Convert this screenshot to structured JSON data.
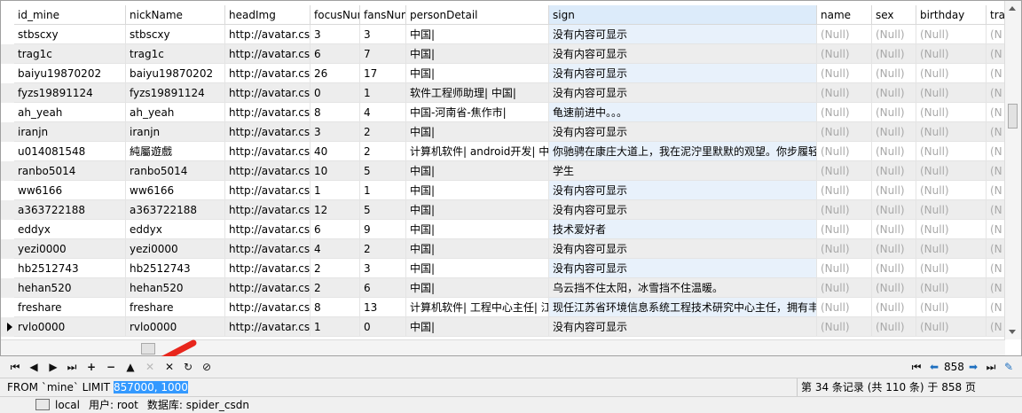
{
  "columns": [
    "id_mine",
    "nickName",
    "headImg",
    "focusNum",
    "fansNum",
    "personDetail",
    "sign",
    "name",
    "sex",
    "birthday",
    "tra"
  ],
  "rows": [
    [
      "stbscxy",
      "stbscxy",
      "http://avatar.csd",
      "3",
      "3",
      "中国|",
      "没有内容可显示",
      "(Null)",
      "(Null)",
      "(Null)",
      "(N"
    ],
    [
      "trag1c",
      "trag1c",
      "http://avatar.csd",
      "6",
      "7",
      "中国|",
      "没有内容可显示",
      "(Null)",
      "(Null)",
      "(Null)",
      "(N"
    ],
    [
      "baiyu19870202",
      "baiyu19870202",
      "http://avatar.csd",
      "26",
      "17",
      "中国|",
      "没有内容可显示",
      "(Null)",
      "(Null)",
      "(Null)",
      "(N"
    ],
    [
      "fyzs19891124",
      "fyzs19891124",
      "http://avatar.csd",
      "0",
      "1",
      "软件工程师助理| 中国|",
      "没有内容可显示",
      "(Null)",
      "(Null)",
      "(Null)",
      "(N"
    ],
    [
      "ah_yeah",
      "ah_yeah",
      "http://avatar.csd",
      "8",
      "4",
      "中国-河南省-焦作市|",
      "龟速前进中。。。",
      "(Null)",
      "(Null)",
      "(Null)",
      "(N"
    ],
    [
      "iranjn",
      "iranjn",
      "http://avatar.csd",
      "3",
      "2",
      "中国|",
      "没有内容可显示",
      "(Null)",
      "(Null)",
      "(Null)",
      "(N"
    ],
    [
      "u014081548",
      "純屬遊戲",
      "http://avatar.csd",
      "40",
      "2",
      "计算机软件| android开发| 中",
      "你驰骋在康庄大道上，我在泥泞里默默的观望。你步履轻",
      "(Null)",
      "(Null)",
      "(Null)",
      "(N"
    ],
    [
      "ranbo5014",
      "ranbo5014",
      "http://avatar.csd",
      "10",
      "5",
      "中国|",
      "学生",
      "(Null)",
      "(Null)",
      "(Null)",
      "(N"
    ],
    [
      "ww6166",
      "ww6166",
      "http://avatar.csd",
      "1",
      "1",
      "中国|",
      "没有内容可显示",
      "(Null)",
      "(Null)",
      "(Null)",
      "(N"
    ],
    [
      "a363722188",
      "a363722188",
      "http://avatar.csd",
      "12",
      "5",
      "中国|",
      "没有内容可显示",
      "(Null)",
      "(Null)",
      "(Null)",
      "(N"
    ],
    [
      "eddyx",
      "eddyx",
      "http://avatar.csd",
      "6",
      "9",
      "中国|",
      "技术爱好者",
      "(Null)",
      "(Null)",
      "(Null)",
      "(N"
    ],
    [
      "yezi0000",
      "yezi0000",
      "http://avatar.csd",
      "4",
      "2",
      "中国|",
      "没有内容可显示",
      "(Null)",
      "(Null)",
      "(Null)",
      "(N"
    ],
    [
      "hb2512743",
      "hb2512743",
      "http://avatar.csd",
      "2",
      "3",
      "中国|",
      "没有内容可显示",
      "(Null)",
      "(Null)",
      "(Null)",
      "(N"
    ],
    [
      "hehan520",
      "hehan520",
      "http://avatar.csd",
      "2",
      "6",
      "中国|",
      "乌云挡不住太阳，冰雪挡不住温暖。",
      "(Null)",
      "(Null)",
      "(Null)",
      "(N"
    ],
    [
      "freshare",
      "freshare",
      "http://avatar.csd",
      "8",
      "13",
      "计算机软件| 工程中心主任| 江",
      "现任江苏省环境信息系统工程技术研究中心主任，拥有丰",
      "(Null)",
      "(Null)",
      "(Null)",
      "(N"
    ],
    [
      "rvlo0000",
      "rvlo0000",
      "http://avatar.csd",
      "1",
      "0",
      "中国|",
      "没有内容可显示",
      "(Null)",
      "(Null)",
      "(Null)",
      "(N"
    ]
  ],
  "sql": {
    "prefix": "FROM `mine` LIMIT ",
    "highlighted": "857000, 1000"
  },
  "record_info": "第 34 条记录 (共 110 条) 于 858 页",
  "pager": {
    "page": "858"
  },
  "connection": {
    "host": "local",
    "user": "用户: root",
    "database": "数据库: spider_csdn"
  },
  "toolbar": {
    "buttons": [
      "first-record",
      "previous-record",
      "next-record",
      "last-record",
      "add-record",
      "delete-record",
      "apply-changes",
      "discard-changes",
      "refresh",
      "stop"
    ]
  }
}
